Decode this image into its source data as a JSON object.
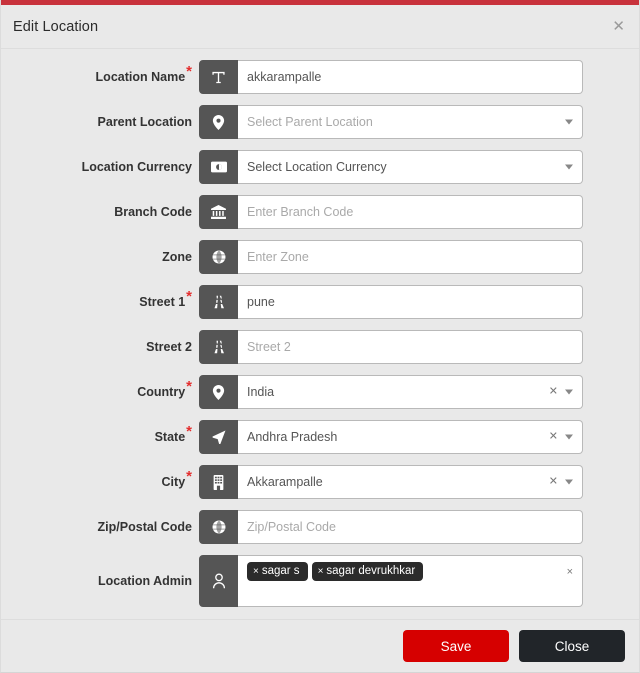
{
  "dialog": {
    "title": "Edit Location",
    "close_icon": "close-icon",
    "accent_color": "#c8323c"
  },
  "fields": [
    {
      "label": "Location Name",
      "required": true,
      "icon": "text-format-icon",
      "value": "akkarampalle",
      "placeholder": "",
      "type": "text",
      "has_caret": false,
      "has_clear": false
    },
    {
      "label": "Parent Location",
      "required": false,
      "icon": "map-pin-icon",
      "value": "",
      "placeholder": "Select Parent Location",
      "type": "select",
      "has_caret": true,
      "has_clear": false
    },
    {
      "label": "Location Currency",
      "required": false,
      "icon": "money-icon",
      "value": "Select Location Currency",
      "placeholder": "",
      "type": "select",
      "has_caret": true,
      "has_clear": false
    },
    {
      "label": "Branch Code",
      "required": false,
      "icon": "bank-icon",
      "value": "",
      "placeholder": "Enter Branch Code",
      "type": "text",
      "has_caret": false,
      "has_clear": false
    },
    {
      "label": "Zone",
      "required": false,
      "icon": "globe-icon",
      "value": "",
      "placeholder": "Enter Zone",
      "type": "text",
      "has_caret": false,
      "has_clear": false
    },
    {
      "label": "Street 1",
      "required": true,
      "icon": "road-icon",
      "value": "pune",
      "placeholder": "",
      "type": "text",
      "has_caret": false,
      "has_clear": false
    },
    {
      "label": "Street 2",
      "required": false,
      "icon": "road-icon",
      "value": "",
      "placeholder": "Street 2",
      "type": "text",
      "has_caret": false,
      "has_clear": false
    },
    {
      "label": "Country",
      "required": true,
      "icon": "map-pin-icon",
      "value": "India",
      "placeholder": "",
      "type": "select",
      "has_caret": true,
      "has_clear": true
    },
    {
      "label": "State",
      "required": true,
      "icon": "navigation-arrow-icon",
      "value": "Andhra Pradesh",
      "placeholder": "",
      "type": "select",
      "has_caret": true,
      "has_clear": true
    },
    {
      "label": "City",
      "required": true,
      "icon": "building-icon",
      "value": "Akkarampalle",
      "placeholder": "",
      "type": "select",
      "has_caret": true,
      "has_clear": true
    },
    {
      "label": "Zip/Postal Code",
      "required": false,
      "icon": "globe-icon",
      "value": "",
      "placeholder": "Zip/Postal Code",
      "type": "text",
      "has_caret": false,
      "has_clear": false
    }
  ],
  "location_admin": {
    "label": "Location Admin",
    "icon": "user-icon",
    "tags": [
      "sagar s",
      "sagar devrukhkar"
    ],
    "tag_remove_glyph": "×",
    "clear_all_glyph": "×"
  },
  "footer": {
    "save_label": "Save",
    "close_label": "Close",
    "save_color": "#d60000",
    "close_color": "#212529"
  }
}
